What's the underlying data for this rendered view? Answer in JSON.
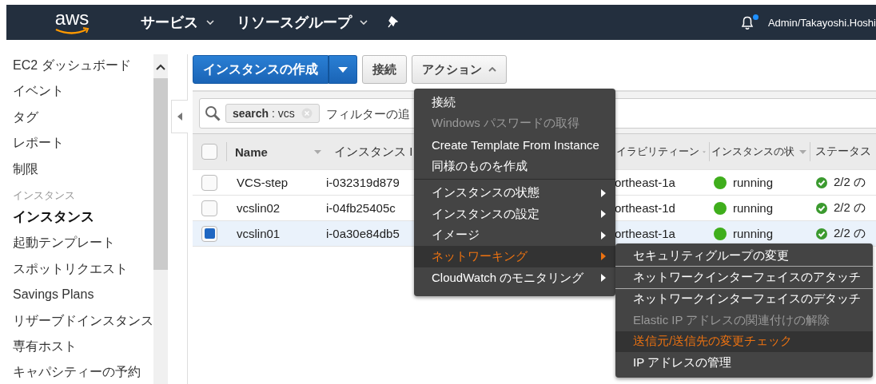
{
  "top_nav": {
    "logo": "aws",
    "menus": [
      {
        "label": "サービス"
      },
      {
        "label": "リソースグループ"
      }
    ],
    "notification_unread": true,
    "account": "Admin/Takayoshi.Hoshi"
  },
  "sidebar": {
    "items": [
      {
        "kind": "link",
        "label": "EC2 ダッシュボード",
        "selected": false
      },
      {
        "kind": "link",
        "label": "イベント",
        "selected": false
      },
      {
        "kind": "link",
        "label": "タグ",
        "selected": false
      },
      {
        "kind": "link",
        "label": "レポート",
        "selected": false
      },
      {
        "kind": "link",
        "label": "制限",
        "selected": false
      },
      {
        "kind": "heading",
        "label": "インスタンス"
      },
      {
        "kind": "link",
        "label": "インスタンス",
        "selected": true
      },
      {
        "kind": "link",
        "label": "起動テンプレート",
        "selected": false
      },
      {
        "kind": "link",
        "label": "スポットリクエスト",
        "selected": false
      },
      {
        "kind": "link",
        "label": "Savings Plans",
        "selected": false
      },
      {
        "kind": "link",
        "label": "リザーブドインスタンス",
        "selected": false
      },
      {
        "kind": "link",
        "label": "専有ホスト",
        "selected": false
      },
      {
        "kind": "link",
        "label": "キャパシティーの予約",
        "selected": false
      }
    ]
  },
  "toolbar": {
    "buttons": [
      {
        "kind": "primary",
        "label": "インスタンスの作成"
      },
      {
        "kind": "plain",
        "label": "接続"
      },
      {
        "kind": "dropdown",
        "label": "アクション",
        "expanded": true
      }
    ]
  },
  "filter": {
    "tokens": [
      {
        "text": "**search** : vcs"
      }
    ],
    "placeholder": "フィルターの追"
  },
  "table": {
    "all_checked": false,
    "columns": [
      {
        "label": "Name",
        "sortable": true
      },
      {
        "label": "インスタンス I"
      },
      {
        "label": "イラビリティーン",
        "sortable": true
      },
      {
        "label": "インスタンスの状",
        "sortable": true
      },
      {
        "label": "ステータス"
      }
    ],
    "rows": [
      {
        "checked": false,
        "selected": false,
        "name": "VCS-step",
        "instance_id": "i-032319d879",
        "column_3": "ortheast-1a",
        "state": "running",
        "status": "2/2 の"
      },
      {
        "checked": false,
        "selected": false,
        "name": "vcslin02",
        "instance_id": "i-04fb25405c",
        "column_3": "ortheast-1d",
        "state": "running",
        "status": "2/2 の"
      },
      {
        "checked": true,
        "selected": true,
        "name": "vcslin01",
        "instance_id": "i-0a30e84db5",
        "column_3": "ortheast-1a",
        "state": "running",
        "status": "2/2 の"
      }
    ]
  },
  "actions_menu": {
    "items": [
      {
        "kind": "item",
        "label": "接続",
        "disabled": false,
        "highlighted": false,
        "submenu": false
      },
      {
        "kind": "item",
        "label": "Windows パスワードの取得",
        "disabled": true,
        "highlighted": false,
        "submenu": false
      },
      {
        "kind": "item",
        "label": "Create Template From Instance",
        "disabled": false,
        "highlighted": false,
        "submenu": false
      },
      {
        "kind": "item",
        "label": "同様のものを作成",
        "disabled": false,
        "highlighted": false,
        "submenu": false
      },
      {
        "kind": "separator"
      },
      {
        "kind": "item",
        "label": "インスタンスの状態",
        "disabled": false,
        "highlighted": false,
        "submenu": true
      },
      {
        "kind": "item",
        "label": "インスタンスの設定",
        "disabled": false,
        "highlighted": false,
        "submenu": true
      },
      {
        "kind": "item",
        "label": "イメージ",
        "disabled": false,
        "highlighted": false,
        "submenu": true
      },
      {
        "kind": "item",
        "label": "ネットワーキング",
        "disabled": false,
        "highlighted": true,
        "submenu": true
      },
      {
        "kind": "item",
        "label": "CloudWatch のモニタリング",
        "disabled": false,
        "highlighted": false,
        "submenu": true
      }
    ]
  },
  "networking_submenu": {
    "items": [
      {
        "kind": "item",
        "label": "セキュリティグループの変更",
        "disabled": false,
        "highlighted": false
      },
      {
        "kind": "separator"
      },
      {
        "kind": "item",
        "label": "ネットワークインターフェイスのアタッチ",
        "disabled": false,
        "highlighted": false
      },
      {
        "kind": "separator"
      },
      {
        "kind": "item",
        "label": "ネットワークインターフェイスのデタッチ",
        "disabled": false,
        "highlighted": false
      },
      {
        "kind": "item",
        "label": "Elastic IP アドレスの関連付けの解除",
        "disabled": true,
        "highlighted": false
      },
      {
        "kind": "item",
        "label": "送信元/送信先の変更チェック",
        "disabled": false,
        "highlighted": true
      },
      {
        "kind": "item",
        "label": "IP アドレスの管理",
        "disabled": false,
        "highlighted": false
      }
    ]
  }
}
